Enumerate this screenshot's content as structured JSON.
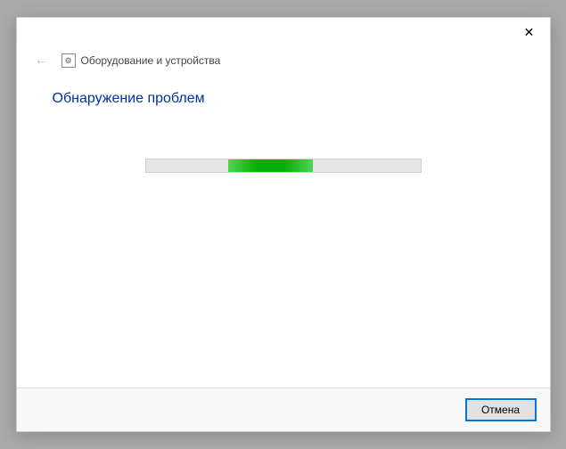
{
  "titlebar": {
    "close": "✕"
  },
  "breadcrumb": {
    "back": "←",
    "icon_glyph": "⚙",
    "title": "Оборудование и устройства"
  },
  "main": {
    "heading": "Обнаружение проблем",
    "progress": {
      "indeterminate": true,
      "block_position_percent": 30,
      "block_width_percent": 31
    }
  },
  "footer": {
    "cancel_label": "Отмена"
  }
}
